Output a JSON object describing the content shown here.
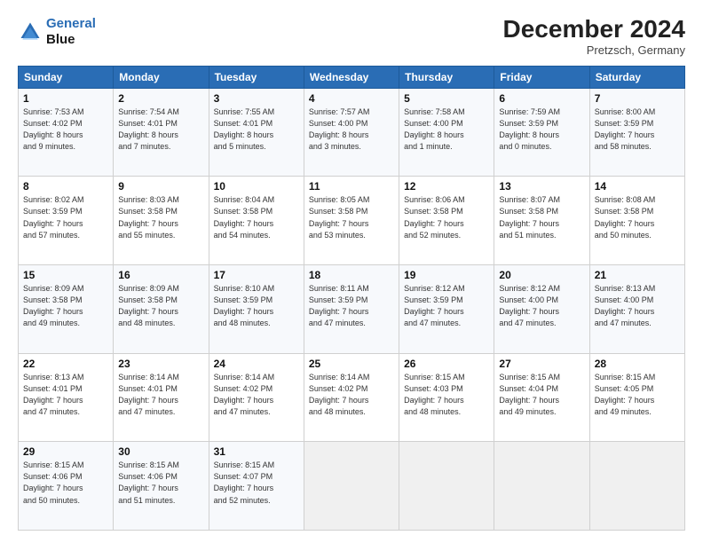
{
  "header": {
    "logo_line1": "General",
    "logo_line2": "Blue",
    "month_year": "December 2024",
    "location": "Pretzsch, Germany"
  },
  "weekdays": [
    "Sunday",
    "Monday",
    "Tuesday",
    "Wednesday",
    "Thursday",
    "Friday",
    "Saturday"
  ],
  "weeks": [
    [
      {
        "day": "1",
        "info": "Sunrise: 7:53 AM\nSunset: 4:02 PM\nDaylight: 8 hours\nand 9 minutes."
      },
      {
        "day": "2",
        "info": "Sunrise: 7:54 AM\nSunset: 4:01 PM\nDaylight: 8 hours\nand 7 minutes."
      },
      {
        "day": "3",
        "info": "Sunrise: 7:55 AM\nSunset: 4:01 PM\nDaylight: 8 hours\nand 5 minutes."
      },
      {
        "day": "4",
        "info": "Sunrise: 7:57 AM\nSunset: 4:00 PM\nDaylight: 8 hours\nand 3 minutes."
      },
      {
        "day": "5",
        "info": "Sunrise: 7:58 AM\nSunset: 4:00 PM\nDaylight: 8 hours\nand 1 minute."
      },
      {
        "day": "6",
        "info": "Sunrise: 7:59 AM\nSunset: 3:59 PM\nDaylight: 8 hours\nand 0 minutes."
      },
      {
        "day": "7",
        "info": "Sunrise: 8:00 AM\nSunset: 3:59 PM\nDaylight: 7 hours\nand 58 minutes."
      }
    ],
    [
      {
        "day": "8",
        "info": "Sunrise: 8:02 AM\nSunset: 3:59 PM\nDaylight: 7 hours\nand 57 minutes."
      },
      {
        "day": "9",
        "info": "Sunrise: 8:03 AM\nSunset: 3:58 PM\nDaylight: 7 hours\nand 55 minutes."
      },
      {
        "day": "10",
        "info": "Sunrise: 8:04 AM\nSunset: 3:58 PM\nDaylight: 7 hours\nand 54 minutes."
      },
      {
        "day": "11",
        "info": "Sunrise: 8:05 AM\nSunset: 3:58 PM\nDaylight: 7 hours\nand 53 minutes."
      },
      {
        "day": "12",
        "info": "Sunrise: 8:06 AM\nSunset: 3:58 PM\nDaylight: 7 hours\nand 52 minutes."
      },
      {
        "day": "13",
        "info": "Sunrise: 8:07 AM\nSunset: 3:58 PM\nDaylight: 7 hours\nand 51 minutes."
      },
      {
        "day": "14",
        "info": "Sunrise: 8:08 AM\nSunset: 3:58 PM\nDaylight: 7 hours\nand 50 minutes."
      }
    ],
    [
      {
        "day": "15",
        "info": "Sunrise: 8:09 AM\nSunset: 3:58 PM\nDaylight: 7 hours\nand 49 minutes."
      },
      {
        "day": "16",
        "info": "Sunrise: 8:09 AM\nSunset: 3:58 PM\nDaylight: 7 hours\nand 48 minutes."
      },
      {
        "day": "17",
        "info": "Sunrise: 8:10 AM\nSunset: 3:59 PM\nDaylight: 7 hours\nand 48 minutes."
      },
      {
        "day": "18",
        "info": "Sunrise: 8:11 AM\nSunset: 3:59 PM\nDaylight: 7 hours\nand 47 minutes."
      },
      {
        "day": "19",
        "info": "Sunrise: 8:12 AM\nSunset: 3:59 PM\nDaylight: 7 hours\nand 47 minutes."
      },
      {
        "day": "20",
        "info": "Sunrise: 8:12 AM\nSunset: 4:00 PM\nDaylight: 7 hours\nand 47 minutes."
      },
      {
        "day": "21",
        "info": "Sunrise: 8:13 AM\nSunset: 4:00 PM\nDaylight: 7 hours\nand 47 minutes."
      }
    ],
    [
      {
        "day": "22",
        "info": "Sunrise: 8:13 AM\nSunset: 4:01 PM\nDaylight: 7 hours\nand 47 minutes."
      },
      {
        "day": "23",
        "info": "Sunrise: 8:14 AM\nSunset: 4:01 PM\nDaylight: 7 hours\nand 47 minutes."
      },
      {
        "day": "24",
        "info": "Sunrise: 8:14 AM\nSunset: 4:02 PM\nDaylight: 7 hours\nand 47 minutes."
      },
      {
        "day": "25",
        "info": "Sunrise: 8:14 AM\nSunset: 4:02 PM\nDaylight: 7 hours\nand 48 minutes."
      },
      {
        "day": "26",
        "info": "Sunrise: 8:15 AM\nSunset: 4:03 PM\nDaylight: 7 hours\nand 48 minutes."
      },
      {
        "day": "27",
        "info": "Sunrise: 8:15 AM\nSunset: 4:04 PM\nDaylight: 7 hours\nand 49 minutes."
      },
      {
        "day": "28",
        "info": "Sunrise: 8:15 AM\nSunset: 4:05 PM\nDaylight: 7 hours\nand 49 minutes."
      }
    ],
    [
      {
        "day": "29",
        "info": "Sunrise: 8:15 AM\nSunset: 4:06 PM\nDaylight: 7 hours\nand 50 minutes."
      },
      {
        "day": "30",
        "info": "Sunrise: 8:15 AM\nSunset: 4:06 PM\nDaylight: 7 hours\nand 51 minutes."
      },
      {
        "day": "31",
        "info": "Sunrise: 8:15 AM\nSunset: 4:07 PM\nDaylight: 7 hours\nand 52 minutes."
      },
      {
        "day": "",
        "info": ""
      },
      {
        "day": "",
        "info": ""
      },
      {
        "day": "",
        "info": ""
      },
      {
        "day": "",
        "info": ""
      }
    ]
  ]
}
